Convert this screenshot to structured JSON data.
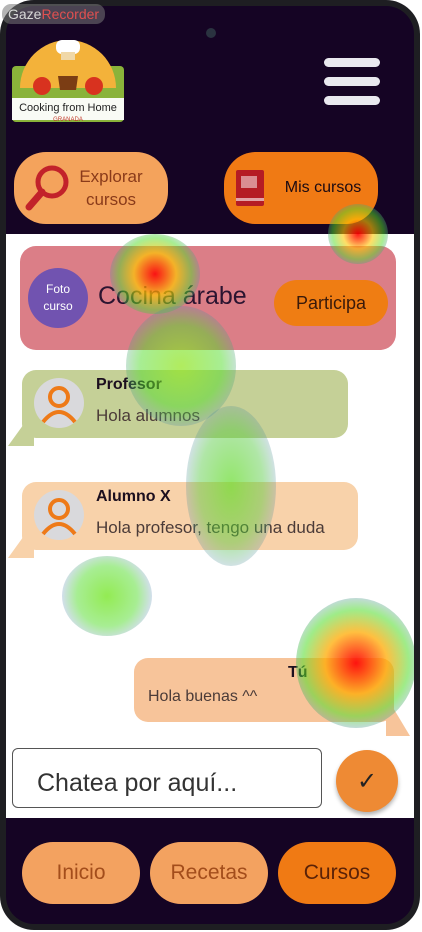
{
  "overlay": {
    "gaze_part1": "Gaze",
    "gaze_part2": "Recorder"
  },
  "header": {
    "logo_title": "Cooking from Home",
    "logo_subtitle": "GRANADA"
  },
  "top_buttons": {
    "explore": {
      "line1": "Explorar",
      "line2": "cursos"
    },
    "my_courses": "Mis cursos"
  },
  "course": {
    "photo_line1": "Foto",
    "photo_line2": "curso",
    "title": "Cocina árabe",
    "join_label": "Participa"
  },
  "messages": [
    {
      "sender": "Profesor",
      "text": "Hola alumnos"
    },
    {
      "sender": "Alumno X",
      "text": "Hola profesor, tengo una duda"
    },
    {
      "sender": "Tú",
      "text": "Hola buenas ^^"
    }
  ],
  "composer": {
    "placeholder": "Chatea por aquí...",
    "send_icon": "checkmark-icon"
  },
  "bottom_nav": [
    {
      "label": "Inicio"
    },
    {
      "label": "Recetas"
    },
    {
      "label": "Cursos",
      "active": true
    }
  ],
  "colors": {
    "header_bg": "#150424",
    "accent_orange": "#f07a14",
    "light_orange": "#f3a260",
    "course_card": "#db7e87",
    "teacher_bubble": "#c5d097",
    "student_bubble": "#f8d2aa"
  }
}
